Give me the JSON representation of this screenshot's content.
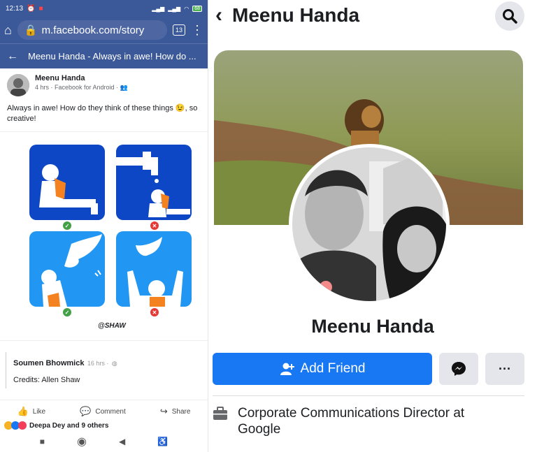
{
  "left": {
    "status": {
      "time": "12:13",
      "battery": "68"
    },
    "browser": {
      "url": "m.facebook.com/story",
      "tabs": "13"
    },
    "title": "Meenu Handa - Always in awe! How do ...",
    "post": {
      "author": "Meenu Handa",
      "meta": "4 hrs · Facebook for Android ·",
      "text": "Always in awe! How do they think of these things 😉, so creative!",
      "signature": "@SHAW"
    },
    "comment": {
      "author": "Soumen Bhowmick",
      "time": "16 hrs ·",
      "text": "Credits: Allen Shaw"
    },
    "actions": {
      "like": "Like",
      "comment": "Comment",
      "share": "Share"
    },
    "reactions": "Deepa Dey and 9 others"
  },
  "right": {
    "header_name": "Meenu Handa",
    "profile_name": "Meenu Handa",
    "add_friend": "Add Friend",
    "more": "···",
    "job": "Corporate Communications Director at Google"
  }
}
